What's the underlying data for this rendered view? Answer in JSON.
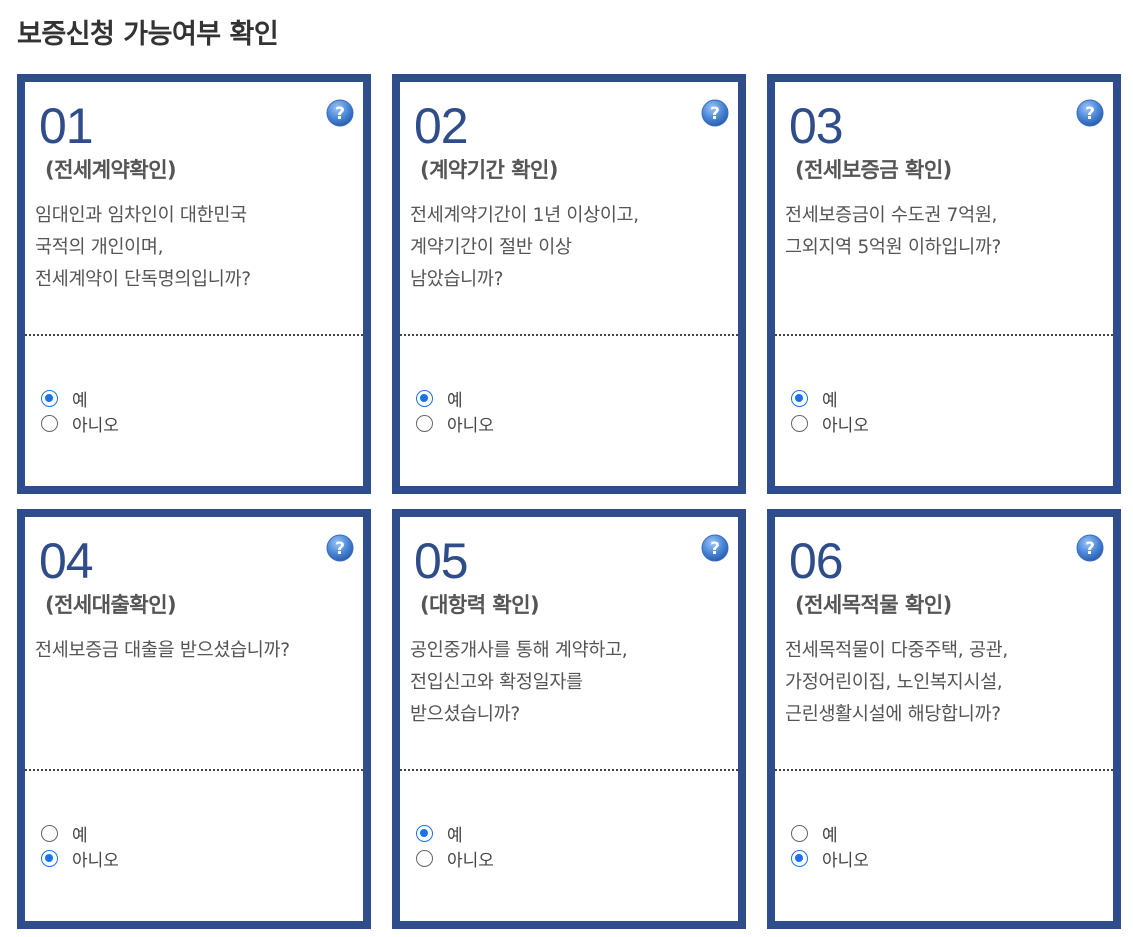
{
  "page_title": "보증신청 가능여부 확인",
  "colors": {
    "card_border": "#2e4d8a",
    "radio_accent": "#1a73e8",
    "help_icon": "#4a86d8"
  },
  "help_icon_name": "question-mark-icon",
  "cards": [
    {
      "number": "01",
      "subtitle": "(전세계약확인)",
      "lines": [
        "임대인과 임차인이 대한민국",
        "국적의 개인이며,",
        "전세계약이 단독명의입니까?"
      ],
      "yes_label": "예",
      "no_label": "아니오",
      "selected": "yes"
    },
    {
      "number": "02",
      "subtitle": "(계약기간 확인)",
      "lines": [
        "전세계약기간이 1년 이상이고,",
        "계약기간이 절반 이상",
        "남았습니까?"
      ],
      "yes_label": "예",
      "no_label": "아니오",
      "selected": "yes"
    },
    {
      "number": "03",
      "subtitle": "(전세보증금 확인)",
      "lines": [
        "전세보증금이 수도권 7억원,",
        "그외지역 5억원 이하입니까?",
        ""
      ],
      "yes_label": "예",
      "no_label": "아니오",
      "selected": "yes"
    },
    {
      "number": "04",
      "subtitle": "(전세대출확인)",
      "lines": [
        "전세보증금 대출을 받으셨습니까?",
        "",
        ""
      ],
      "yes_label": "예",
      "no_label": "아니오",
      "selected": "no"
    },
    {
      "number": "05",
      "subtitle": "(대항력 확인)",
      "lines": [
        "공인중개사를 통해 계약하고,",
        "전입신고와 확정일자를",
        "받으셨습니까?"
      ],
      "yes_label": "예",
      "no_label": "아니오",
      "selected": "yes"
    },
    {
      "number": "06",
      "subtitle": "(전세목적물 확인)",
      "lines": [
        "전세목적물이 다중주택, 공관,",
        "가정어린이집, 노인복지시설,",
        "근린생활시설에 해당합니까?"
      ],
      "yes_label": "예",
      "no_label": "아니오",
      "selected": "no"
    }
  ]
}
